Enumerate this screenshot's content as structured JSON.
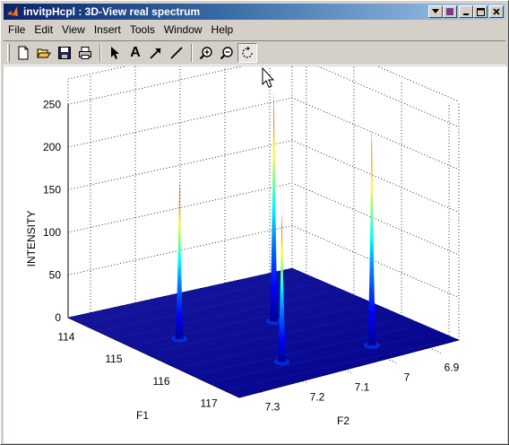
{
  "window": {
    "title": "invitpHcpl : 3D-View real spectrum",
    "icon": "matlab-logo-icon",
    "controls": [
      "dock-icon",
      "minimize-icon",
      "maximize-icon",
      "close-icon"
    ]
  },
  "menubar": {
    "items": [
      {
        "name": "menu-file",
        "label": "File"
      },
      {
        "name": "menu-edit",
        "label": "Edit"
      },
      {
        "name": "menu-view",
        "label": "View"
      },
      {
        "name": "menu-insert",
        "label": "Insert"
      },
      {
        "name": "menu-tools",
        "label": "Tools"
      },
      {
        "name": "menu-window",
        "label": "Window"
      },
      {
        "name": "menu-help",
        "label": "Help"
      }
    ]
  },
  "toolbar": {
    "tools": [
      "new-file-icon",
      "open-folder-icon",
      "save-icon",
      "print-icon",
      "select-arrow-icon",
      "insert-text-icon",
      "insert-arrow-icon",
      "insert-line-icon",
      "zoom-in-icon",
      "zoom-out-icon",
      "rotate-3d-icon"
    ],
    "text_tool_label": "A",
    "active_tool": "rotate-3d-icon"
  },
  "chart_data": {
    "type": "surface",
    "title": "",
    "zlabel": "INTENSITY",
    "xlabel": "F1",
    "ylabel": "F2",
    "zticks": [
      "0",
      "50",
      "100",
      "150",
      "200",
      "250"
    ],
    "xticks": [
      "114",
      "115",
      "116",
      "117"
    ],
    "yticks": [
      "6.9",
      "7",
      "7.1",
      "7.2",
      "7.3"
    ],
    "zlim": [
      0,
      300
    ],
    "grid": true,
    "colormap": [
      "#00008f",
      "#0000ff",
      "#0080ff",
      "#00ffff",
      "#80ff80",
      "#ffff00",
      "#ff8000",
      "#ff0000",
      "#800000"
    ],
    "peaks": [
      {
        "F1": 115.1,
        "F2": 7.25,
        "intensity": 185
      },
      {
        "F1": 115.2,
        "F2": 7.05,
        "intensity": 270
      },
      {
        "F1": 116.5,
        "F2": 7.17,
        "intensity": 175
      },
      {
        "F1": 116.6,
        "F2": 6.98,
        "intensity": 255
      }
    ]
  }
}
